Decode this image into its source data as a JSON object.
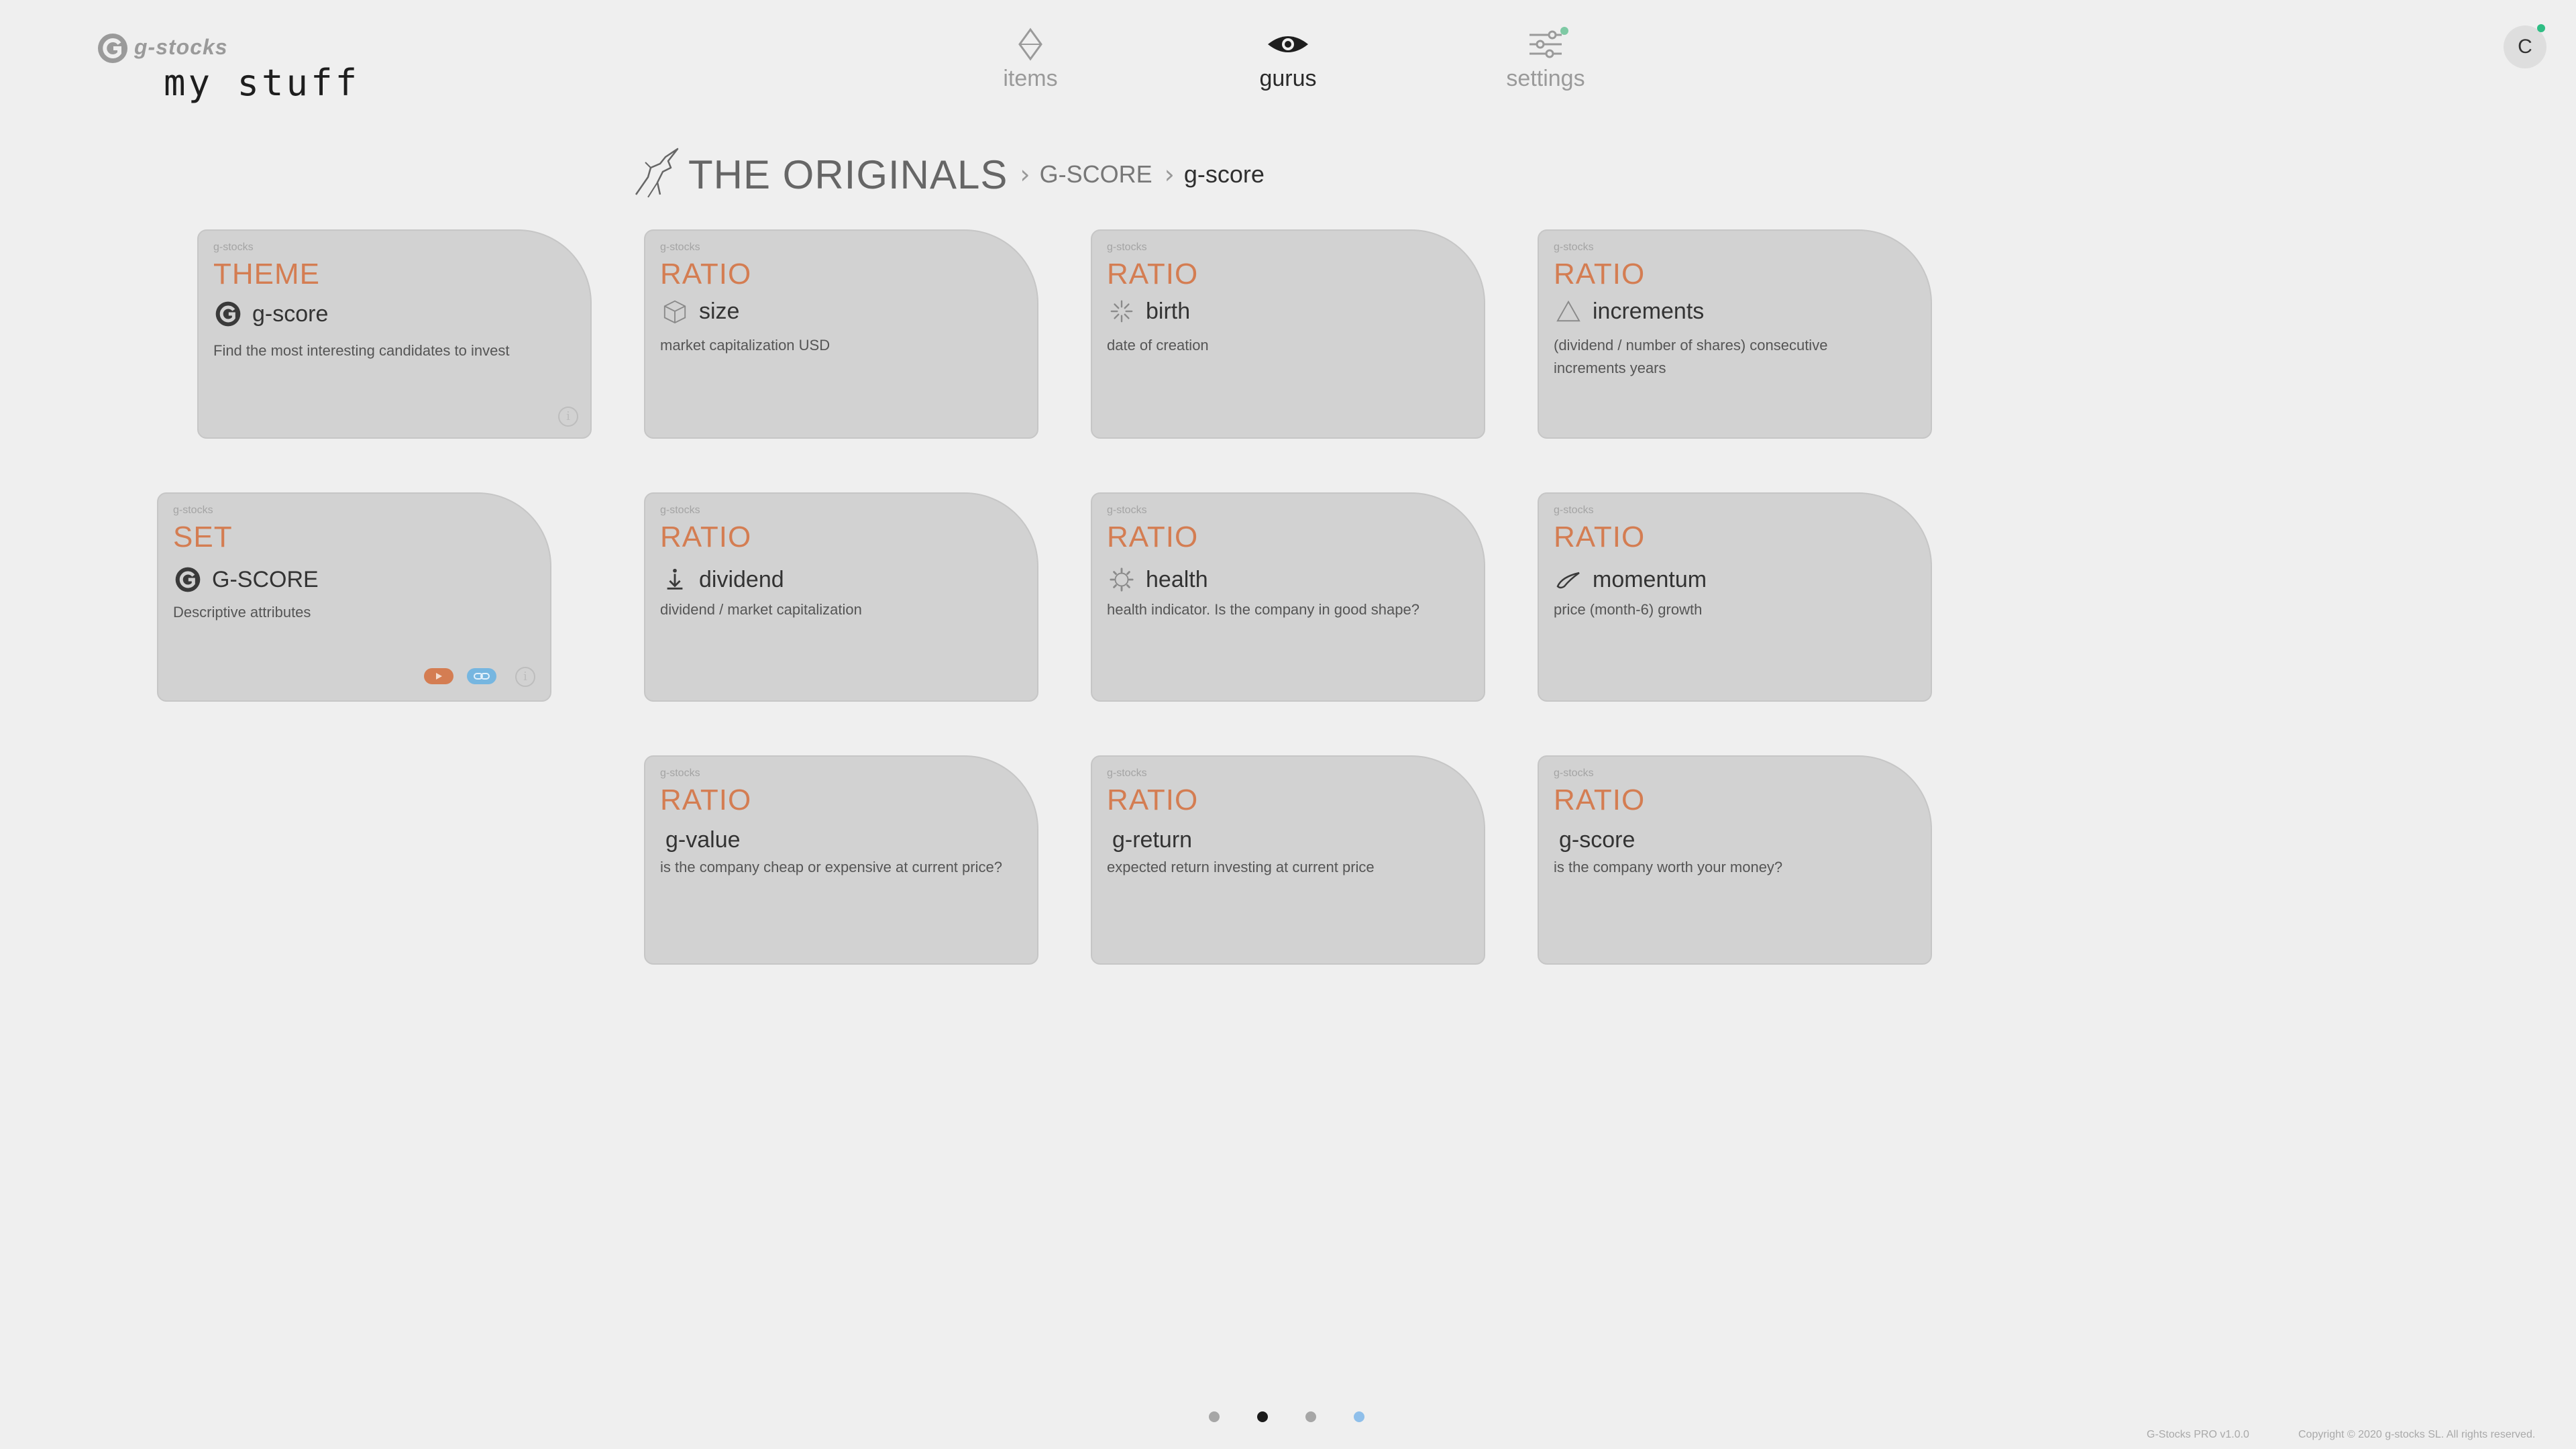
{
  "brand": {
    "name": "g-stocks",
    "title": "my stuff"
  },
  "nav": {
    "items": [
      {
        "label": "items",
        "icon": "diamond-icon"
      },
      {
        "label": "gurus",
        "icon": "eye-icon",
        "active": true
      },
      {
        "label": "settings",
        "icon": "sliders-icon",
        "notification": true
      }
    ]
  },
  "user": {
    "avatar_initial": "C"
  },
  "breadcrumb": {
    "icon": "unicorn-icon",
    "root": "THE ORIGINALS",
    "middle": "G-SCORE",
    "current": "g-score"
  },
  "cards": [
    {
      "source": "g-stocks",
      "type": "THEME",
      "title": "g-score",
      "icon": "g-logo-icon",
      "description": "Find the most interesting candidates to invest"
    },
    {
      "source": "g-stocks",
      "type": "RATIO",
      "title": "size",
      "icon": "cube-icon",
      "description": "market capitalization USD"
    },
    {
      "source": "g-stocks",
      "type": "RATIO",
      "title": "birth",
      "icon": "sparkle-icon",
      "description": "date of creation"
    },
    {
      "source": "g-stocks",
      "type": "RATIO",
      "title": "increments",
      "icon": "triangle-icon",
      "description": "(dividend / number of shares) consecutive increments years"
    },
    {
      "source": "g-stocks",
      "type": "SET",
      "title": "G-SCORE",
      "icon": "g-logo-icon",
      "description": "Descriptive attributes"
    },
    {
      "source": "g-stocks",
      "type": "RATIO",
      "title": "dividend",
      "icon": "dividend-icon",
      "description": "dividend / market capitalization"
    },
    {
      "source": "g-stocks",
      "type": "RATIO",
      "title": "health",
      "icon": "gear-icon",
      "description": "health indicator. Is the company in good shape?"
    },
    {
      "source": "g-stocks",
      "type": "RATIO",
      "title": "momentum",
      "icon": "swoosh-icon",
      "description": "price (month-6) growth"
    },
    {
      "source": "g-stocks",
      "type": "RATIO",
      "title": "g-value",
      "description": "is the company cheap or expensive at current price?"
    },
    {
      "source": "g-stocks",
      "type": "RATIO",
      "title": "g-return",
      "description": "expected return investing at current price"
    },
    {
      "source": "g-stocks",
      "type": "RATIO",
      "title": "g-score",
      "description": "is the company worth your money?"
    }
  ],
  "pagination": {
    "pages": 4,
    "current": 2
  },
  "footer": {
    "version": "G-Stocks PRO v1.0.0",
    "copyright": "Copyright © 2020 g-stocks SL. All rights reserved."
  },
  "colors": {
    "background": "#efefef",
    "card": "#d2d2d2",
    "accent": "#d47d52",
    "active_dot": "#1a1a1a",
    "highlight_dot": "#8fbfea"
  }
}
